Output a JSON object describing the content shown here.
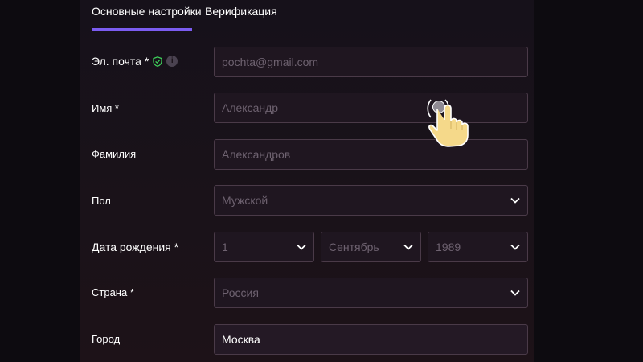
{
  "tabs": [
    {
      "label": "Основные настройки",
      "active": true
    },
    {
      "label": "Верификация",
      "active": false
    }
  ],
  "form": {
    "email": {
      "label": "Эл. почта *",
      "placeholder": "pochta@gmail.com"
    },
    "first_name": {
      "label": "Имя *",
      "placeholder": "Александр"
    },
    "last_name": {
      "label": "Фамилия",
      "placeholder": "Александров"
    },
    "gender": {
      "label": "Пол",
      "value": "Мужской"
    },
    "birth_date": {
      "label": "Дата рождения *",
      "day": "1",
      "month": "Сентябрь",
      "year": "1989"
    },
    "country": {
      "label": "Страна *",
      "value": "Россия"
    },
    "city": {
      "label": "Город",
      "value": "Москва"
    }
  },
  "icons": {
    "verified": "shield-check-icon",
    "info": "info-icon",
    "dropdown": "chevron-down-icon",
    "pointer": "hand-pointer-icon"
  },
  "colors": {
    "accent": "#7b5cf0",
    "verified": "#3ecf5a",
    "field_border": "#4a3a48",
    "hand": "#f5d98a"
  }
}
